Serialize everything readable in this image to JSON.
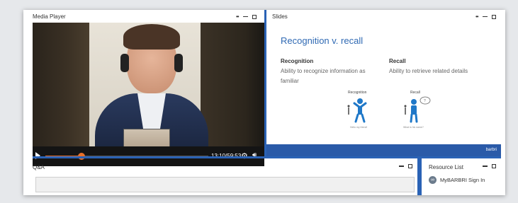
{
  "media_player": {
    "title": "Media Player",
    "time": "13:10/59:53",
    "progress": 0.22
  },
  "slides": {
    "title": "Slides",
    "heading": "Recognition v. recall",
    "recognition": {
      "heading": "Recognition",
      "text": "Ability to recognize information as familiar",
      "figure_label": "Recognition",
      "figure_caption": "Hello my friend!"
    },
    "recall": {
      "heading": "Recall",
      "text": "Ability to retrieve related details",
      "figure_label": "Recall",
      "figure_caption": "What is his name?"
    },
    "brand": "barbri"
  },
  "qa": {
    "title": "Q&A"
  },
  "resource_list": {
    "title": "Resource List",
    "items": [
      {
        "label": "MyBARBRI Sign In",
        "icon": "link-icon"
      }
    ]
  },
  "colors": {
    "accent": "#2a62b5",
    "seek": "#e8702a",
    "slide_title": "#2f69b3"
  }
}
